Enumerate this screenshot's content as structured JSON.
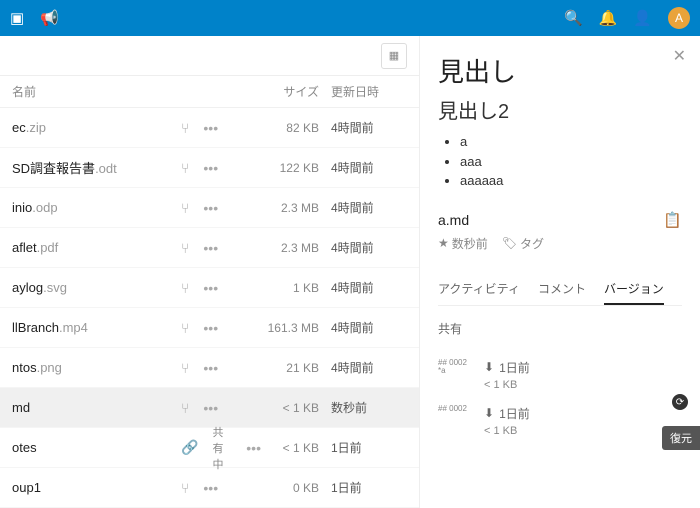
{
  "topbar": {
    "avatar": "A"
  },
  "headers": {
    "name": "名前",
    "size": "サイズ",
    "date": "更新日時"
  },
  "files": [
    {
      "name": "ec",
      "ext": ".zip",
      "size": "82 KB",
      "date": "4時間前",
      "shared": false,
      "link": false,
      "selected": false
    },
    {
      "name": "SD調査報告書",
      "ext": ".odt",
      "size": "122 KB",
      "date": "4時間前",
      "shared": false,
      "link": false,
      "selected": false
    },
    {
      "name": "inio",
      "ext": ".odp",
      "size": "2.3 MB",
      "date": "4時間前",
      "shared": false,
      "link": false,
      "selected": false
    },
    {
      "name": "aflet",
      "ext": ".pdf",
      "size": "2.3 MB",
      "date": "4時間前",
      "shared": false,
      "link": false,
      "selected": false
    },
    {
      "name": "aylog",
      "ext": ".svg",
      "size": "1 KB",
      "date": "4時間前",
      "shared": false,
      "link": false,
      "selected": false
    },
    {
      "name": "llBranch",
      "ext": ".mp4",
      "size": "161.3 MB",
      "date": "4時間前",
      "shared": false,
      "link": false,
      "selected": false
    },
    {
      "name": "ntos",
      "ext": ".png",
      "size": "21 KB",
      "date": "4時間前",
      "shared": false,
      "link": false,
      "selected": false
    },
    {
      "name": "md",
      "ext": "",
      "size": "< 1 KB",
      "date": "数秒前",
      "shared": false,
      "link": false,
      "selected": true
    },
    {
      "name": "otes",
      "ext": "",
      "size": "< 1 KB",
      "date": "1日前",
      "shared": true,
      "sharedLabel": "共有中",
      "link": true,
      "selected": false
    },
    {
      "name": "oup1",
      "ext": "",
      "size": "0 KB",
      "date": "1日前",
      "shared": false,
      "link": false,
      "selected": false
    }
  ],
  "preview": {
    "h1": "見出し",
    "h2": "見出し2",
    "items": [
      "a",
      "aaa",
      "aaaaaa"
    ],
    "filename": "a.md",
    "metaTime": "数秒前",
    "metaTag": "タグ"
  },
  "tabs": {
    "activity": "アクティビティ",
    "comments": "コメント",
    "versions": "バージョン",
    "share": "共有"
  },
  "versions": [
    {
      "thumb": "## 0002\n*a",
      "date": "1日前",
      "size": "< 1 KB"
    },
    {
      "thumb": "## 0002",
      "date": "1日前",
      "size": "< 1 KB"
    }
  ],
  "restore": "復元"
}
